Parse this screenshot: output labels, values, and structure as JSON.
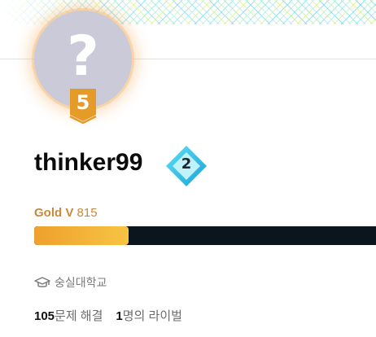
{
  "profile": {
    "avatar_glyph": "?",
    "tier_level": "5",
    "username": "thinker99",
    "rank_badge": "2",
    "tier_name": "Gold V",
    "rating": "815",
    "progress_fraction": 0.27,
    "school": "숭실대학교",
    "school_icon": "graduation-cap-icon",
    "solved_count": "105",
    "solved_label": "문제 해결",
    "rival_count": "1",
    "rival_label": "명의 라이벌"
  },
  "colors": {
    "tier_gold": "#c8893a",
    "badge_orange": "#e59b28",
    "rank_badge": "#2bc6e6",
    "progress_track": "#0b151d",
    "progress_fill_start": "#eea02e",
    "progress_fill_end": "#f7c443",
    "avatar_bg": "#cbcad9"
  }
}
